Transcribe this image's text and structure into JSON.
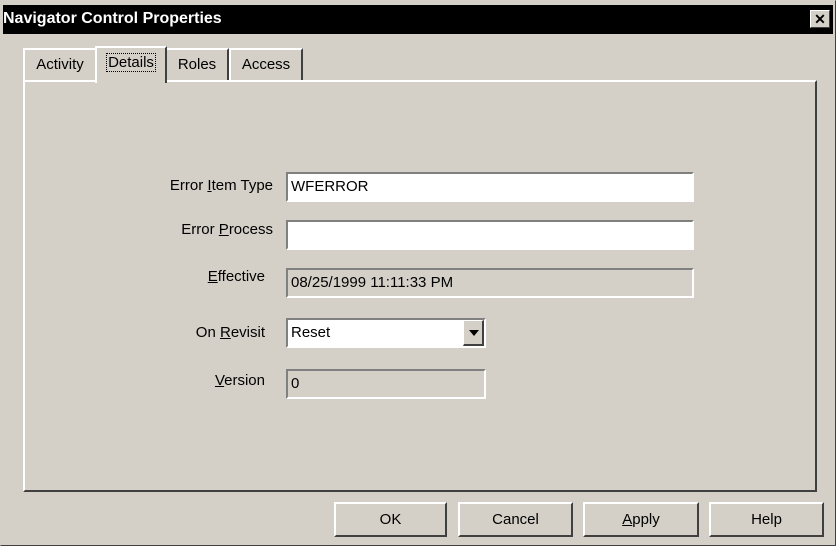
{
  "window": {
    "title": "Navigator Control Properties",
    "close_glyph": "✕"
  },
  "tabs": [
    {
      "label": "Activity"
    },
    {
      "label": "Details"
    },
    {
      "label": "Roles"
    },
    {
      "label": "Access"
    }
  ],
  "details": {
    "error_item_type": {
      "label_pre": "Error ",
      "label_key": "I",
      "label_post": "tem Type",
      "value": "WFERROR"
    },
    "error_process": {
      "label_pre": "Error ",
      "label_key": "P",
      "label_post": "rocess",
      "value": ""
    },
    "effective": {
      "label_pre": "",
      "label_key": "E",
      "label_post": "ffective",
      "value": "08/25/1999 11:11:33 PM"
    },
    "on_revisit": {
      "label_pre": "On ",
      "label_key": "R",
      "label_post": "evisit",
      "value": "Reset"
    },
    "version": {
      "label_pre": "",
      "label_key": "V",
      "label_post": "ersion",
      "value": "0"
    }
  },
  "buttons": {
    "ok": "OK",
    "cancel": "Cancel",
    "apply_key": "A",
    "apply_rest": "pply",
    "help": "Help"
  }
}
